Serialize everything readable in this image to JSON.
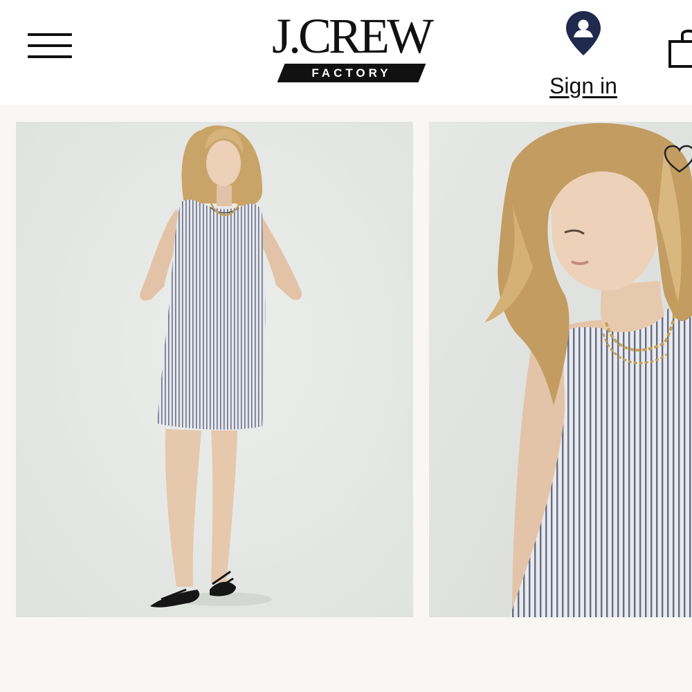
{
  "header": {
    "brand": "J.CREW",
    "brand_sub": "FACTORY",
    "signin_label": "Sign in"
  },
  "icons": {
    "menu": "hamburger-menu-icon",
    "account": "account-pin-icon",
    "bag": "shopping-bag-icon",
    "favorite": "heart-icon"
  },
  "colors": {
    "accent_navy": "#1f2a4e",
    "text": "#111111",
    "page_background": "#f8f7f4",
    "photo_background": "#e3e5e3"
  },
  "gallery": {
    "images": [
      {
        "description_icon": "product-photo-full-body"
      },
      {
        "description_icon": "product-photo-closeup"
      }
    ]
  }
}
